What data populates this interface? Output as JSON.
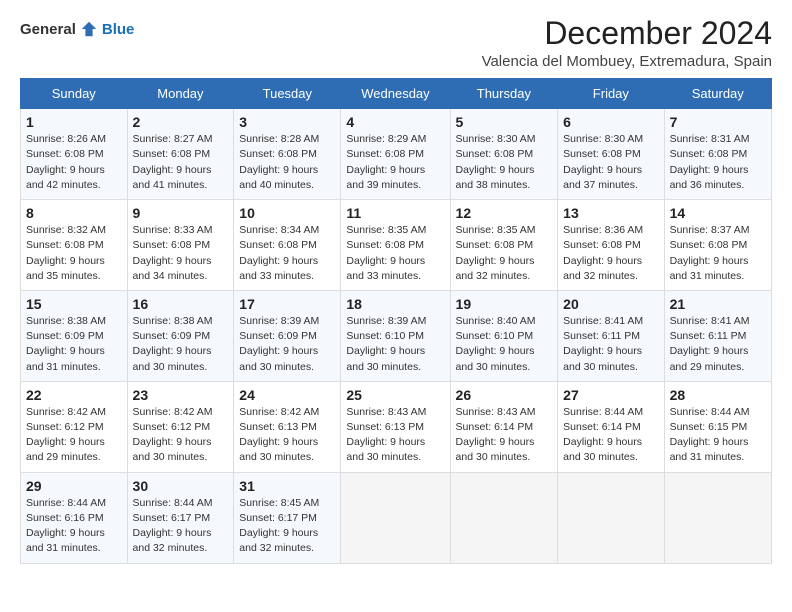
{
  "logo": {
    "general": "General",
    "blue": "Blue"
  },
  "title": "December 2024",
  "subtitle": "Valencia del Mombuey, Extremadura, Spain",
  "headers": [
    "Sunday",
    "Monday",
    "Tuesday",
    "Wednesday",
    "Thursday",
    "Friday",
    "Saturday"
  ],
  "weeks": [
    [
      {
        "day": "1",
        "sunrise": "Sunrise: 8:26 AM",
        "sunset": "Sunset: 6:08 PM",
        "daylight": "Daylight: 9 hours and 42 minutes."
      },
      {
        "day": "2",
        "sunrise": "Sunrise: 8:27 AM",
        "sunset": "Sunset: 6:08 PM",
        "daylight": "Daylight: 9 hours and 41 minutes."
      },
      {
        "day": "3",
        "sunrise": "Sunrise: 8:28 AM",
        "sunset": "Sunset: 6:08 PM",
        "daylight": "Daylight: 9 hours and 40 minutes."
      },
      {
        "day": "4",
        "sunrise": "Sunrise: 8:29 AM",
        "sunset": "Sunset: 6:08 PM",
        "daylight": "Daylight: 9 hours and 39 minutes."
      },
      {
        "day": "5",
        "sunrise": "Sunrise: 8:30 AM",
        "sunset": "Sunset: 6:08 PM",
        "daylight": "Daylight: 9 hours and 38 minutes."
      },
      {
        "day": "6",
        "sunrise": "Sunrise: 8:30 AM",
        "sunset": "Sunset: 6:08 PM",
        "daylight": "Daylight: 9 hours and 37 minutes."
      },
      {
        "day": "7",
        "sunrise": "Sunrise: 8:31 AM",
        "sunset": "Sunset: 6:08 PM",
        "daylight": "Daylight: 9 hours and 36 minutes."
      }
    ],
    [
      {
        "day": "8",
        "sunrise": "Sunrise: 8:32 AM",
        "sunset": "Sunset: 6:08 PM",
        "daylight": "Daylight: 9 hours and 35 minutes."
      },
      {
        "day": "9",
        "sunrise": "Sunrise: 8:33 AM",
        "sunset": "Sunset: 6:08 PM",
        "daylight": "Daylight: 9 hours and 34 minutes."
      },
      {
        "day": "10",
        "sunrise": "Sunrise: 8:34 AM",
        "sunset": "Sunset: 6:08 PM",
        "daylight": "Daylight: 9 hours and 33 minutes."
      },
      {
        "day": "11",
        "sunrise": "Sunrise: 8:35 AM",
        "sunset": "Sunset: 6:08 PM",
        "daylight": "Daylight: 9 hours and 33 minutes."
      },
      {
        "day": "12",
        "sunrise": "Sunrise: 8:35 AM",
        "sunset": "Sunset: 6:08 PM",
        "daylight": "Daylight: 9 hours and 32 minutes."
      },
      {
        "day": "13",
        "sunrise": "Sunrise: 8:36 AM",
        "sunset": "Sunset: 6:08 PM",
        "daylight": "Daylight: 9 hours and 32 minutes."
      },
      {
        "day": "14",
        "sunrise": "Sunrise: 8:37 AM",
        "sunset": "Sunset: 6:08 PM",
        "daylight": "Daylight: 9 hours and 31 minutes."
      }
    ],
    [
      {
        "day": "15",
        "sunrise": "Sunrise: 8:38 AM",
        "sunset": "Sunset: 6:09 PM",
        "daylight": "Daylight: 9 hours and 31 minutes."
      },
      {
        "day": "16",
        "sunrise": "Sunrise: 8:38 AM",
        "sunset": "Sunset: 6:09 PM",
        "daylight": "Daylight: 9 hours and 30 minutes."
      },
      {
        "day": "17",
        "sunrise": "Sunrise: 8:39 AM",
        "sunset": "Sunset: 6:09 PM",
        "daylight": "Daylight: 9 hours and 30 minutes."
      },
      {
        "day": "18",
        "sunrise": "Sunrise: 8:39 AM",
        "sunset": "Sunset: 6:10 PM",
        "daylight": "Daylight: 9 hours and 30 minutes."
      },
      {
        "day": "19",
        "sunrise": "Sunrise: 8:40 AM",
        "sunset": "Sunset: 6:10 PM",
        "daylight": "Daylight: 9 hours and 30 minutes."
      },
      {
        "day": "20",
        "sunrise": "Sunrise: 8:41 AM",
        "sunset": "Sunset: 6:11 PM",
        "daylight": "Daylight: 9 hours and 30 minutes."
      },
      {
        "day": "21",
        "sunrise": "Sunrise: 8:41 AM",
        "sunset": "Sunset: 6:11 PM",
        "daylight": "Daylight: 9 hours and 29 minutes."
      }
    ],
    [
      {
        "day": "22",
        "sunrise": "Sunrise: 8:42 AM",
        "sunset": "Sunset: 6:12 PM",
        "daylight": "Daylight: 9 hours and 29 minutes."
      },
      {
        "day": "23",
        "sunrise": "Sunrise: 8:42 AM",
        "sunset": "Sunset: 6:12 PM",
        "daylight": "Daylight: 9 hours and 30 minutes."
      },
      {
        "day": "24",
        "sunrise": "Sunrise: 8:42 AM",
        "sunset": "Sunset: 6:13 PM",
        "daylight": "Daylight: 9 hours and 30 minutes."
      },
      {
        "day": "25",
        "sunrise": "Sunrise: 8:43 AM",
        "sunset": "Sunset: 6:13 PM",
        "daylight": "Daylight: 9 hours and 30 minutes."
      },
      {
        "day": "26",
        "sunrise": "Sunrise: 8:43 AM",
        "sunset": "Sunset: 6:14 PM",
        "daylight": "Daylight: 9 hours and 30 minutes."
      },
      {
        "day": "27",
        "sunrise": "Sunrise: 8:44 AM",
        "sunset": "Sunset: 6:14 PM",
        "daylight": "Daylight: 9 hours and 30 minutes."
      },
      {
        "day": "28",
        "sunrise": "Sunrise: 8:44 AM",
        "sunset": "Sunset: 6:15 PM",
        "daylight": "Daylight: 9 hours and 31 minutes."
      }
    ],
    [
      {
        "day": "29",
        "sunrise": "Sunrise: 8:44 AM",
        "sunset": "Sunset: 6:16 PM",
        "daylight": "Daylight: 9 hours and 31 minutes."
      },
      {
        "day": "30",
        "sunrise": "Sunrise: 8:44 AM",
        "sunset": "Sunset: 6:17 PM",
        "daylight": "Daylight: 9 hours and 32 minutes."
      },
      {
        "day": "31",
        "sunrise": "Sunrise: 8:45 AM",
        "sunset": "Sunset: 6:17 PM",
        "daylight": "Daylight: 9 hours and 32 minutes."
      },
      null,
      null,
      null,
      null
    ]
  ]
}
